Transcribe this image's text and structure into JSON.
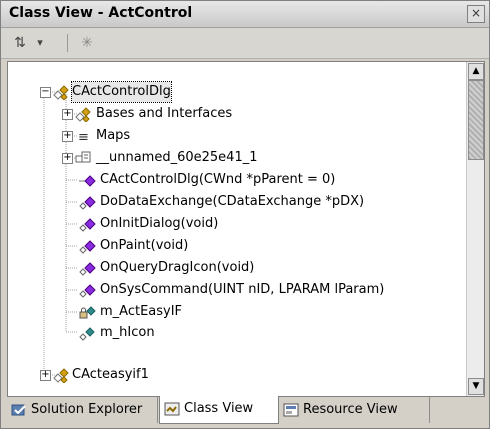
{
  "window": {
    "title": "Class View - ActControl",
    "close_glyph": "×"
  },
  "toolbar": {
    "sort_glyph": "⇅",
    "dropdown_glyph": "▾",
    "newfolder_glyph": "✳"
  },
  "tree": {
    "rows": [
      {
        "label": "CActControlDlg",
        "icon": "class-icon",
        "expander": "−",
        "selected": true
      },
      {
        "label": "Bases and Interfaces",
        "icon": "bases-icon",
        "expander": "+"
      },
      {
        "label": "Maps",
        "icon": "maps-icon",
        "expander": "+",
        "glyph": "≡"
      },
      {
        "label": "__unnamed_60e25e41_1",
        "icon": "enum-icon",
        "expander": "+"
      },
      {
        "label": "CActControlDlg(CWnd *pParent = 0)",
        "icon": "constructor-icon"
      },
      {
        "label": "DoDataExchange(CDataExchange *pDX)",
        "icon": "protected-method-icon"
      },
      {
        "label": "OnInitDialog(void)",
        "icon": "protected-method-icon"
      },
      {
        "label": "OnPaint(void)",
        "icon": "protected-method-icon"
      },
      {
        "label": "OnQueryDragIcon(void)",
        "icon": "protected-method-icon"
      },
      {
        "label": "OnSysCommand(UINT nID, LPARAM lParam)",
        "icon": "protected-method-icon"
      },
      {
        "label": "m_ActEasyIF",
        "icon": "private-field-icon"
      },
      {
        "label": "m_hIcon",
        "icon": "protected-field-icon"
      },
      {
        "label": "CActeasyif1",
        "icon": "class-icon",
        "expander": "+"
      }
    ]
  },
  "scrollbar": {
    "up_glyph": "▲",
    "down_glyph": "▼"
  },
  "tabs": [
    {
      "label": "Solution Explorer",
      "icon": "solution-explorer-icon"
    },
    {
      "label": "Class View",
      "icon": "class-view-icon",
      "active": true
    },
    {
      "label": "Resource View",
      "icon": "resource-view-icon"
    }
  ],
  "colors": {
    "method_purple": "#8a2be2",
    "class_gold": "#d4a017",
    "field_teal": "#2e8b8b",
    "selection": "#e8e8e8"
  }
}
